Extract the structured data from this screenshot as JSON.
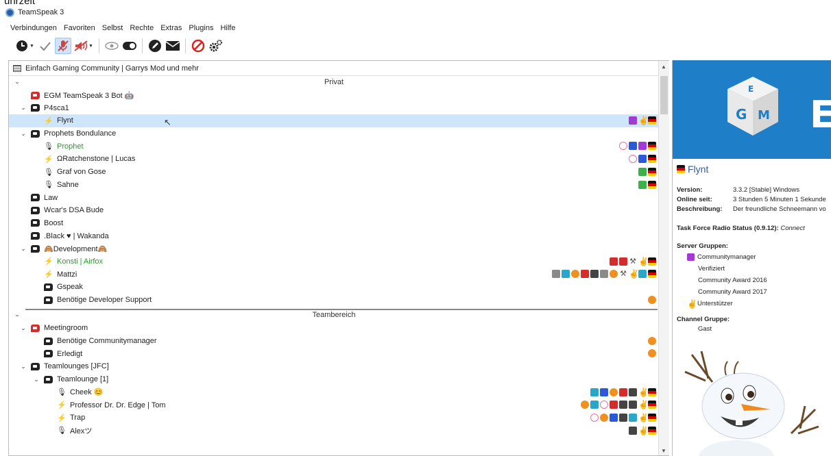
{
  "overlay_text": "uhrzeit",
  "window": {
    "title": "TeamSpeak 3"
  },
  "menu": [
    "Verbindungen",
    "Favoriten",
    "Selbst",
    "Rechte",
    "Extras",
    "Plugins",
    "Hilfe"
  ],
  "server": {
    "name": "Einfach Gaming Community | Garrys Mod und mehr"
  },
  "tree": {
    "sections": [
      {
        "label": "Privat"
      },
      {
        "label": "Teambereich"
      }
    ],
    "privat_rows": [
      {
        "type": "channel",
        "name": "EGM TeamSpeak 3 Bot",
        "indent": 1,
        "red": true,
        "suffix": "🤖"
      },
      {
        "type": "channel",
        "name": "P4sca1",
        "indent": 1,
        "chev": true
      },
      {
        "type": "user",
        "name": "Flynt",
        "indent": 2,
        "sel": true,
        "icon": "muted"
      },
      {
        "type": "channel",
        "name": "Prophets Bondulance",
        "indent": 1,
        "chev": true
      },
      {
        "type": "user",
        "name": "Prophet",
        "indent": 2,
        "green": true,
        "icon": "mic"
      },
      {
        "type": "user",
        "name": "ΩRatchenstone | Lucas",
        "indent": 2,
        "icon": "mute"
      },
      {
        "type": "user",
        "name": "Graf von Gose",
        "indent": 2,
        "icon": "mic"
      },
      {
        "type": "user",
        "name": "Sahne",
        "indent": 2,
        "icon": "mic"
      },
      {
        "type": "channel",
        "name": "Law",
        "indent": 1
      },
      {
        "type": "channel",
        "name": "Wcar's DSA Bude",
        "indent": 1
      },
      {
        "type": "channel",
        "name": "Boost",
        "indent": 1
      },
      {
        "type": "channel",
        "name": ".Black ♥ | Wakanda",
        "indent": 1
      },
      {
        "type": "channel",
        "name": "🙈Development🙈",
        "indent": 1,
        "chev": true
      },
      {
        "type": "user",
        "name": "Konsti | Airfox",
        "indent": 2,
        "green": true,
        "icon": "mute"
      },
      {
        "type": "user",
        "name": "Mattzi",
        "indent": 2,
        "icon": "muted"
      },
      {
        "type": "channel",
        "name": "Gspeak",
        "indent": 2
      },
      {
        "type": "channel",
        "name": "Benötige Developer Support",
        "indent": 2
      }
    ],
    "team_rows": [
      {
        "type": "channel",
        "name": "Meetingroom",
        "indent": 1,
        "red": true,
        "chev": true
      },
      {
        "type": "channel",
        "name": "Benötige Communitymanager",
        "indent": 2
      },
      {
        "type": "channel",
        "name": "Erledigt",
        "indent": 2
      },
      {
        "type": "channel",
        "name": "Teamlounges [JFC]",
        "indent": 1,
        "chev": true
      },
      {
        "type": "channel",
        "name": "Teamlounge [1]",
        "indent": 2,
        "chev": true
      },
      {
        "type": "user",
        "name": "Cheek 😊",
        "indent": 3,
        "icon": "mic"
      },
      {
        "type": "user",
        "name": "Professor Dr. Dr. Edge | Tom",
        "indent": 3,
        "icon": "mute"
      },
      {
        "type": "user",
        "name": "Trap",
        "indent": 3,
        "icon": "mute"
      },
      {
        "type": "user",
        "name": "Alexツ",
        "indent": 3,
        "icon": "mic"
      }
    ]
  },
  "client_info": {
    "name": "Flynt",
    "version_label": "Version:",
    "version": "3.3.2 [Stable] Windows",
    "online_label": "Online seit:",
    "online": "3 Stunden 5 Minuten 1 Sekunde",
    "desc_label": "Beschreibung:",
    "desc": "Der freundliche Schneemann vo",
    "tfr_label": "Task Force Radio Status (0.9.12):",
    "tfr": "Connect",
    "server_groups_label": "Server Gruppen:",
    "server_groups": [
      "Communitymanager",
      "Verifiziert",
      "Community Award 2016",
      "Community Award 2017",
      "Unterstützer"
    ],
    "channel_group_label": "Channel Gruppe:",
    "channel_group": "Gast"
  },
  "colors": {
    "accent": "#1e7fc8",
    "selection": "#cde6fb",
    "green_name": "#2a9a2a"
  }
}
